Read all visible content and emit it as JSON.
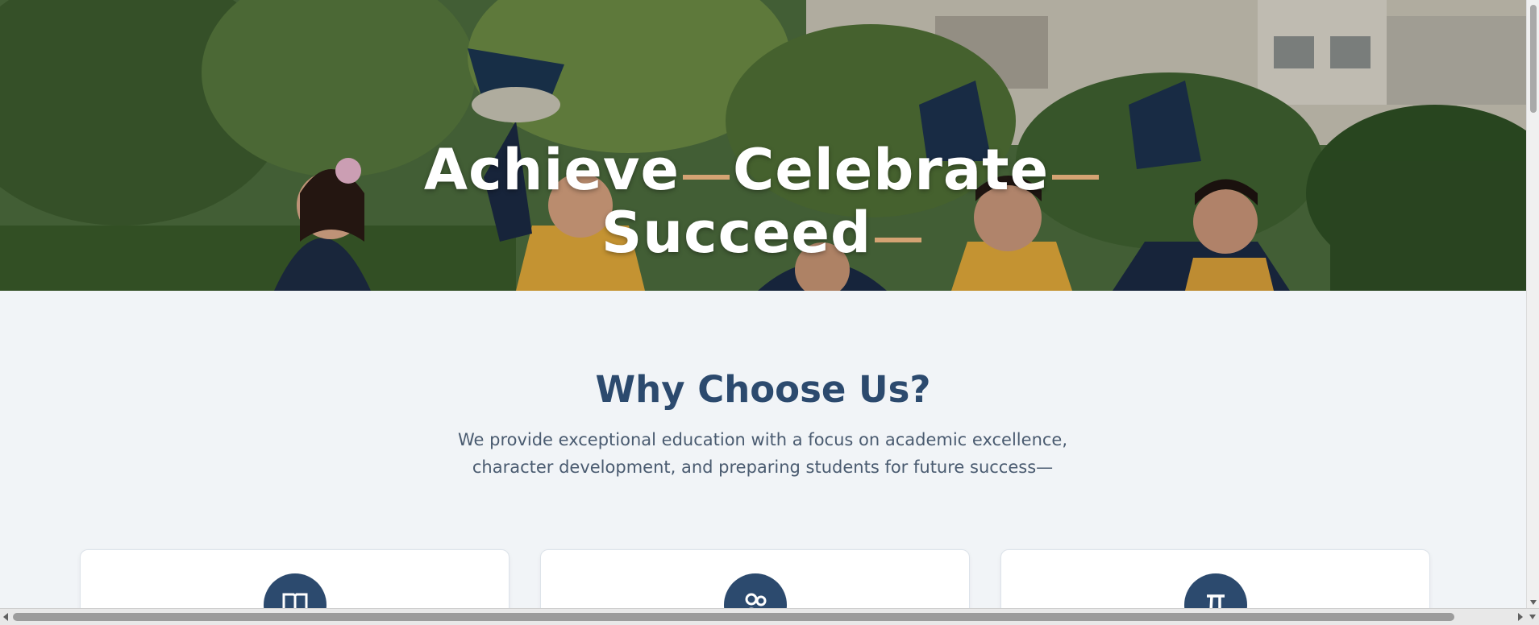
{
  "hero": {
    "title_line1_word1": "Achieve",
    "title_line1_word2": "Celebrate",
    "title_line2_word1": "Succeed",
    "accent_color": "#d4a373",
    "image_alt": "Children in graduation gowns tossing caps outdoors"
  },
  "why": {
    "title": "Why Choose Us?",
    "subtitle": "We provide exceptional education with a focus on academic excellence, character development, and preparing students for future success—",
    "title_color": "#2c4a6e",
    "cards": [
      {
        "icon": "book-icon"
      },
      {
        "icon": "people-icon"
      },
      {
        "icon": "pi-icon"
      }
    ]
  }
}
